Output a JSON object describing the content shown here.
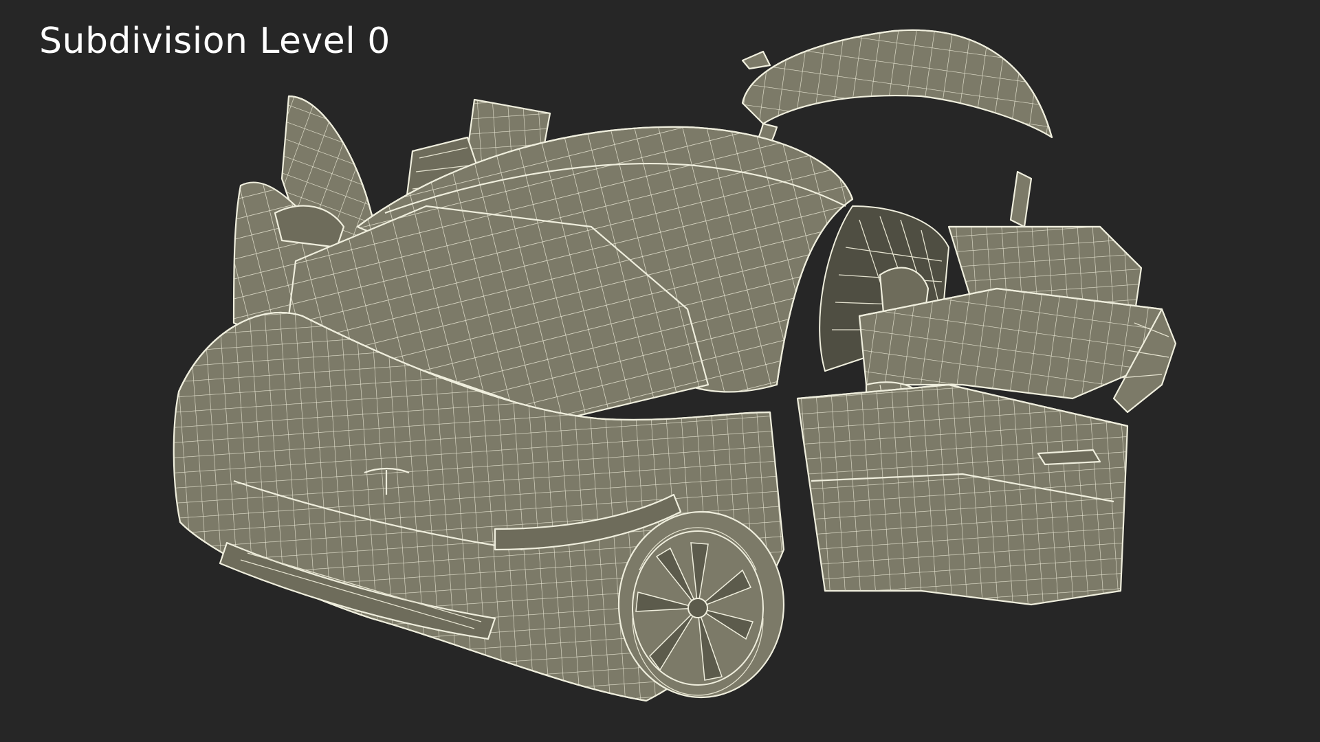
{
  "caption": {
    "text": "Subdivision Level 0"
  },
  "colors": {
    "background": "#262626",
    "mesh_fill": "#7c7a68",
    "wire": "#efeedd",
    "caption_text": "#ffffff"
  }
}
